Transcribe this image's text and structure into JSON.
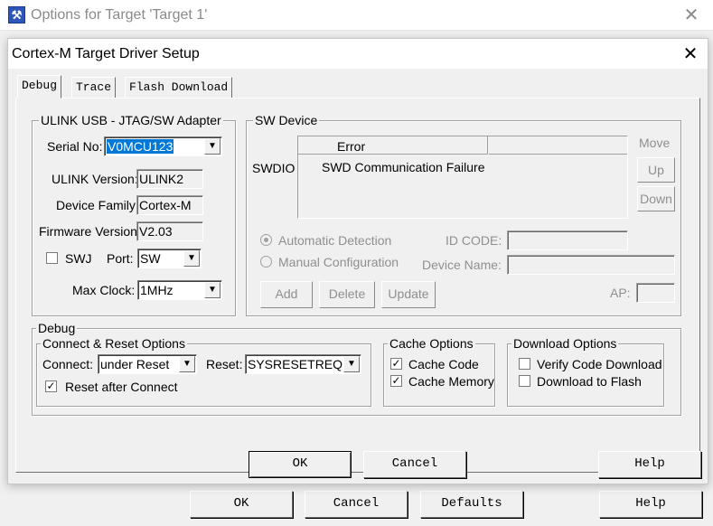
{
  "back_window": {
    "title": "Options for Target 'Target 1'",
    "buttons": {
      "ok": "OK",
      "cancel": "Cancel",
      "defaults": "Defaults",
      "help": "Help"
    }
  },
  "dialog": {
    "title": "Cortex-M Target Driver Setup",
    "tabs": [
      "Debug",
      "Trace",
      "Flash Download"
    ],
    "adapter": {
      "group_title": "ULINK USB - JTAG/SW Adapter",
      "serial_label": "Serial No:",
      "serial_value": "V0MCU123",
      "ulink_version_label": "ULINK Version:",
      "ulink_version_value": "ULINK2",
      "device_family_label": "Device Family:",
      "device_family_value": "Cortex-M",
      "firmware_version_label": "Firmware Version:",
      "firmware_version_value": "V2.03",
      "swj_label": "SWJ",
      "swj_checked": false,
      "port_label": "Port:",
      "port_value": "SW",
      "max_clock_label": "Max Clock:",
      "max_clock_value": "1MHz"
    },
    "sw_device": {
      "group_title": "SW Device",
      "swdio_label": "SWDIO",
      "column_error": "Error",
      "error_text": "SWD Communication Failure",
      "move_label": "Move",
      "up_button": "Up",
      "down_button": "Down",
      "auto_detection": "Automatic Detection",
      "manual_config": "Manual Configuration",
      "id_code_label": "ID CODE:",
      "device_name_label": "Device Name:",
      "add_button": "Add",
      "delete_button": "Delete",
      "update_button": "Update",
      "ap_label": "AP:"
    },
    "debug": {
      "group_title": "Debug",
      "connect_reset": {
        "group_title": "Connect & Reset Options",
        "connect_label": "Connect:",
        "connect_value": "under Reset",
        "reset_label": "Reset:",
        "reset_value": "SYSRESETREQ",
        "reset_after_connect_label": "Reset after Connect",
        "reset_after_connect_checked": true
      },
      "cache": {
        "group_title": "Cache Options",
        "cache_code_label": "Cache Code",
        "cache_code_checked": true,
        "cache_memory_label": "Cache Memory",
        "cache_memory_checked": true
      },
      "download": {
        "group_title": "Download Options",
        "verify_label": "Verify Code Download",
        "verify_checked": false,
        "flash_label": "Download to Flash",
        "flash_checked": false
      }
    },
    "buttons": {
      "ok": "OK",
      "cancel": "Cancel",
      "help": "Help"
    }
  }
}
